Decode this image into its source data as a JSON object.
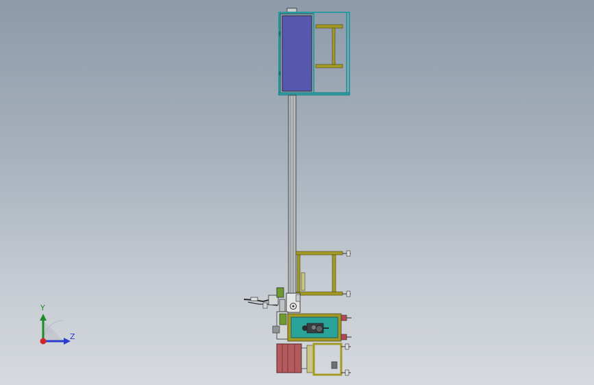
{
  "viewport": {
    "background_top": "#8d9aa9",
    "background_bottom": "#d6dadf"
  },
  "model": {
    "colors": {
      "frame_teal": "#2a9aa0",
      "panel_blue": "#5658b0",
      "frame_olive": "#a39a25",
      "column_gray": "#9fa3a6",
      "roller_red": "#b45a5e",
      "green_block": "#6f9a2f",
      "outline_dark": "#2d2d2d"
    }
  },
  "triad": {
    "y_label": "Y",
    "z_label": "Z",
    "colors": {
      "y": "#1f8a2b",
      "z": "#2b3ccf",
      "x": "#d0262a"
    }
  }
}
